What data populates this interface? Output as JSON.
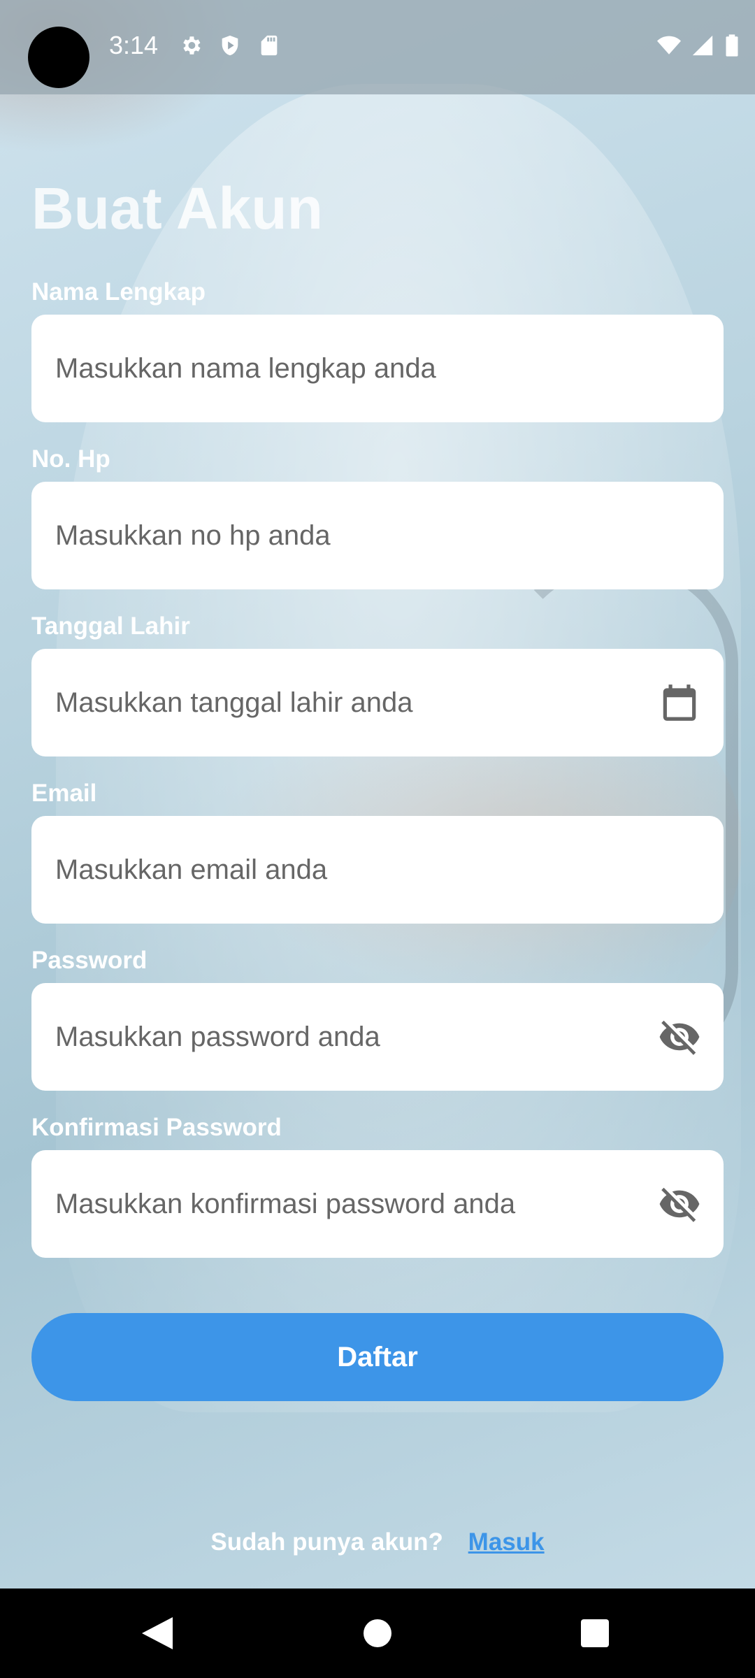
{
  "status_bar": {
    "time": "3:14",
    "left_icons": [
      "gear-icon",
      "shield-play-icon",
      "sd-card-icon"
    ],
    "right_icons": [
      "wifi-icon",
      "signal-icon",
      "battery-icon"
    ]
  },
  "page": {
    "title": "Buat Akun"
  },
  "form": {
    "fields": [
      {
        "label": "Nama Lengkap",
        "placeholder": "Masukkan nama lengkap anda",
        "value": ""
      },
      {
        "label": "No. Hp",
        "placeholder": "Masukkan no hp anda",
        "value": ""
      },
      {
        "label": "Tanggal Lahir",
        "placeholder": "Masukkan tanggal lahir anda",
        "value": "",
        "icon": "calendar-icon"
      },
      {
        "label": "Email",
        "placeholder": "Masukkan email anda",
        "value": ""
      },
      {
        "label": "Password",
        "placeholder": "Masukkan password anda",
        "value": "",
        "icon": "eye-off-icon"
      },
      {
        "label": "Konfirmasi Password",
        "placeholder": "Masukkan konfirmasi password anda",
        "value": "",
        "icon": "eye-off-icon"
      }
    ],
    "submit_label": "Daftar"
  },
  "footer": {
    "text": "Sudah punya akun?",
    "link": "Masuk"
  },
  "nav_bar": {
    "buttons": [
      "back-icon",
      "home-icon",
      "recents-icon"
    ]
  },
  "colors": {
    "accent": "#3d95e8",
    "field_bg": "#ffffff",
    "label": "#ffffff",
    "placeholder": "#666666"
  }
}
